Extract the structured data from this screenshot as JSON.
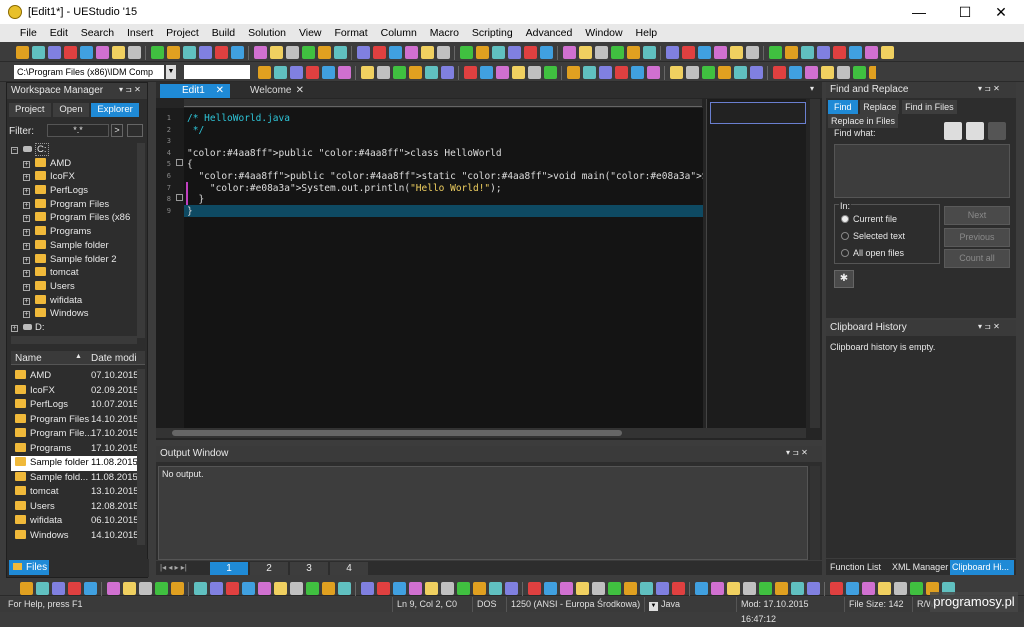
{
  "window": {
    "title": "[Edit1*] - UEStudio '15",
    "min": "—",
    "max": "☐",
    "close": "✕"
  },
  "menu": [
    "File",
    "Edit",
    "Search",
    "Insert",
    "Project",
    "Build",
    "Solution",
    "View",
    "Format",
    "Column",
    "Macro",
    "Scripting",
    "Advanced",
    "Window",
    "Help"
  ],
  "path_combo": "C:\\Program Files (x86)\\IDM Comp",
  "workspace": {
    "title": "Workspace Manager",
    "tabs": [
      "Project",
      "Open",
      "Explorer"
    ],
    "filter_label": "Filter:",
    "filter_value": "*.*",
    "drive_c": "C:",
    "drive_d": "D:",
    "tree": [
      "AMD",
      "IcoFX",
      "PerfLogs",
      "Program Files",
      "Program Files (x86",
      "Programs",
      "Sample folder",
      "Sample folder 2",
      "tomcat",
      "Users",
      "wifidata",
      "Windows"
    ],
    "list_headers": [
      "Name",
      "Date modi"
    ],
    "files": [
      {
        "name": "AMD",
        "date": "07.10.2015"
      },
      {
        "name": "IcoFX",
        "date": "02.09.2015"
      },
      {
        "name": "PerfLogs",
        "date": "10.07.2015"
      },
      {
        "name": "Program Files",
        "date": "14.10.2015"
      },
      {
        "name": "Program File...",
        "date": "17.10.2015"
      },
      {
        "name": "Programs",
        "date": "17.10.2015"
      },
      {
        "name": "Sample folder",
        "date": "11.08.2015"
      },
      {
        "name": "Sample fold...",
        "date": "11.08.2015"
      },
      {
        "name": "tomcat",
        "date": "13.10.2015"
      },
      {
        "name": "Users",
        "date": "12.08.2015"
      },
      {
        "name": "wifidata",
        "date": "06.10.2015"
      },
      {
        "name": "Windows",
        "date": "14.10.2015"
      }
    ],
    "bottom_tab": "Files"
  },
  "editor": {
    "tabs": [
      "Edit1",
      "Welcome"
    ],
    "line_numbers": [
      "1",
      "2",
      "3",
      "4",
      "5",
      "6",
      "7",
      "8",
      "9"
    ],
    "lines": [
      "/* HelloWorld.java",
      " */",
      "",
      "public class HelloWorld",
      "{",
      "  public static void main(String[] args) {",
      "    System.out.println(\"Hello World!\");",
      "  }",
      "}"
    ],
    "page_tabs": [
      "1",
      "2",
      "3",
      "4"
    ]
  },
  "output": {
    "title": "Output Window",
    "text": "No output."
  },
  "find": {
    "title": "Find and Replace",
    "tabs": [
      "Find",
      "Replace",
      "Find in Files",
      "Replace in Files"
    ],
    "find_what_label": "Find what:",
    "in_label": "In:",
    "options": [
      "Current file",
      "Selected text",
      "All open files"
    ],
    "buttons": [
      "Next",
      "Previous",
      "Count all"
    ]
  },
  "clipboard": {
    "title": "Clipboard History",
    "text": "Clipboard history is empty."
  },
  "right_tabs": [
    "Function List",
    "XML Manager",
    "Clipboard Hi..."
  ],
  "statusbar": {
    "help": "For Help, press F1",
    "position": "Ln 9, Col 2, C0",
    "lineend": "DOS",
    "encoding": "1250  (ANSI - Europa Środkowa)",
    "language": "Java",
    "modified": "Mod: 17.10.2015 16:47:12",
    "filesize": "File Size: 142",
    "mode": "R/W"
  },
  "watermark": "programosy.pl",
  "colors": {
    "accent": "#1f8ad6",
    "editor_bg": "#141414",
    "highlight": "#0e4a63"
  }
}
